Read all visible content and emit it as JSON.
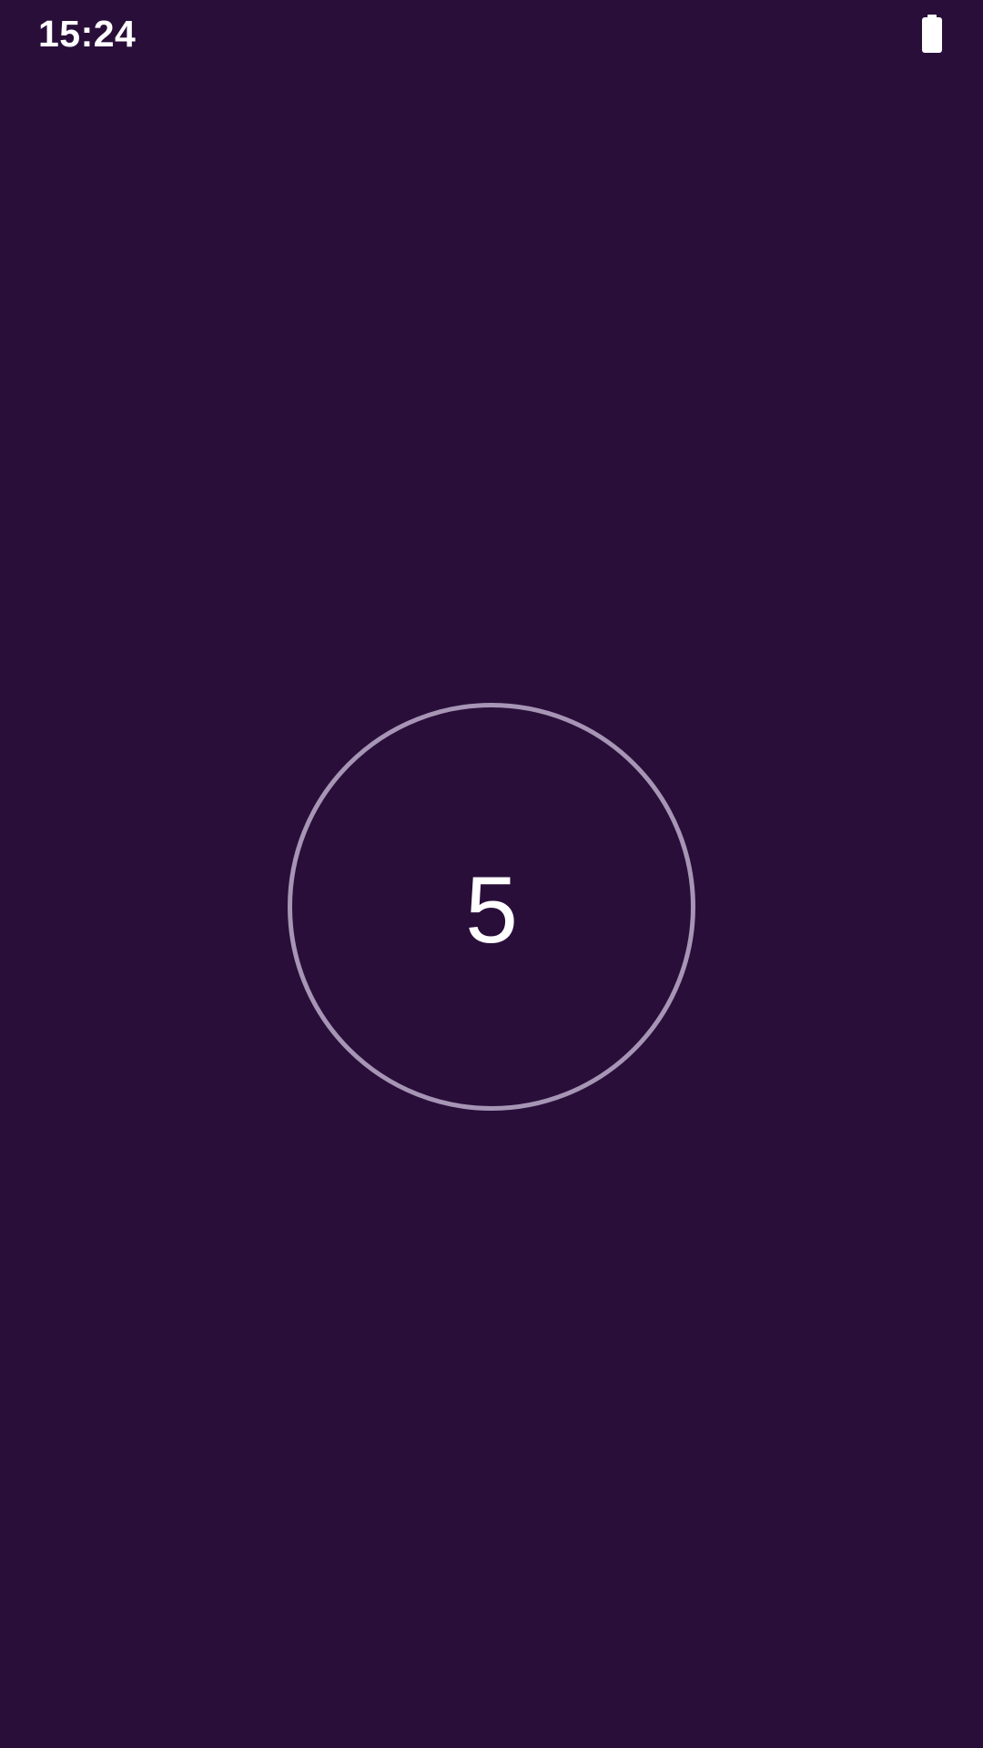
{
  "status_bar": {
    "time": "15:24",
    "battery_icon": "battery-full-icon"
  },
  "countdown": {
    "value": "5"
  },
  "colors": {
    "background": "#290E3A",
    "circle_stroke": "#A795B5",
    "text": "#FFFFFF"
  }
}
